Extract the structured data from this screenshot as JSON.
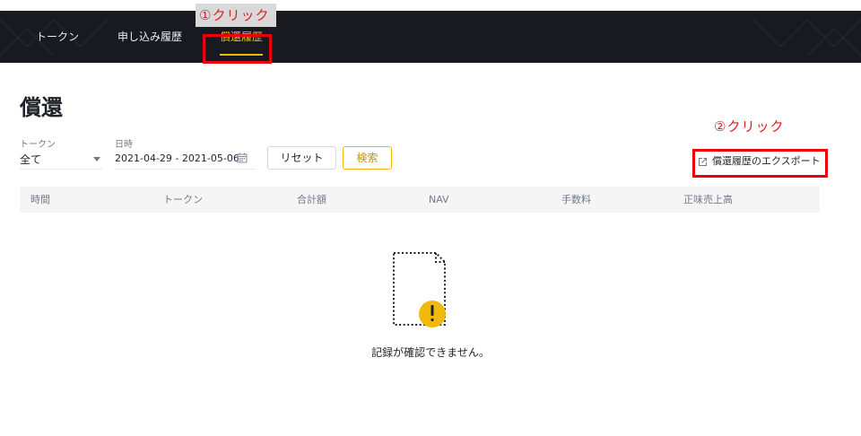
{
  "annotations": {
    "step1": "①クリック",
    "step2": "②クリック"
  },
  "nav": {
    "tabs": [
      {
        "label": "トークン",
        "active": false
      },
      {
        "label": "申し込み履歴",
        "active": false
      },
      {
        "label": "償還履歴",
        "active": true
      }
    ]
  },
  "page": {
    "title": "償還"
  },
  "filters": {
    "token_label": "トークン",
    "token_value": "全て",
    "date_label": "日時",
    "date_value": "2021-04-29 - 2021-05-06",
    "reset_label": "リセット",
    "search_label": "検索"
  },
  "export": {
    "label": "償還履歴のエクスポート"
  },
  "table": {
    "columns": [
      "時間",
      "トークン",
      "合計額",
      "NAV",
      "手数料",
      "正味売上高"
    ]
  },
  "empty": {
    "message": "記録が確認できません。"
  },
  "colors": {
    "navbar_bg": "#181a20",
    "accent": "#f0b90b",
    "annotation_red": "#e8000b"
  }
}
